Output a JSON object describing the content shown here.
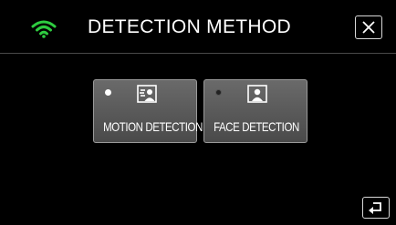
{
  "header": {
    "title": "DETECTION METHOD",
    "wifi_icon": "wifi-icon",
    "close_icon": "close-icon",
    "accent_color": "#2ecc40"
  },
  "options": [
    {
      "label": "MOTION DETECTION",
      "selected": true,
      "icon": "motion-detection-icon"
    },
    {
      "label": "FACE DETECTION",
      "selected": false,
      "icon": "face-detection-icon"
    }
  ],
  "footer": {
    "back_icon": "return-icon"
  }
}
